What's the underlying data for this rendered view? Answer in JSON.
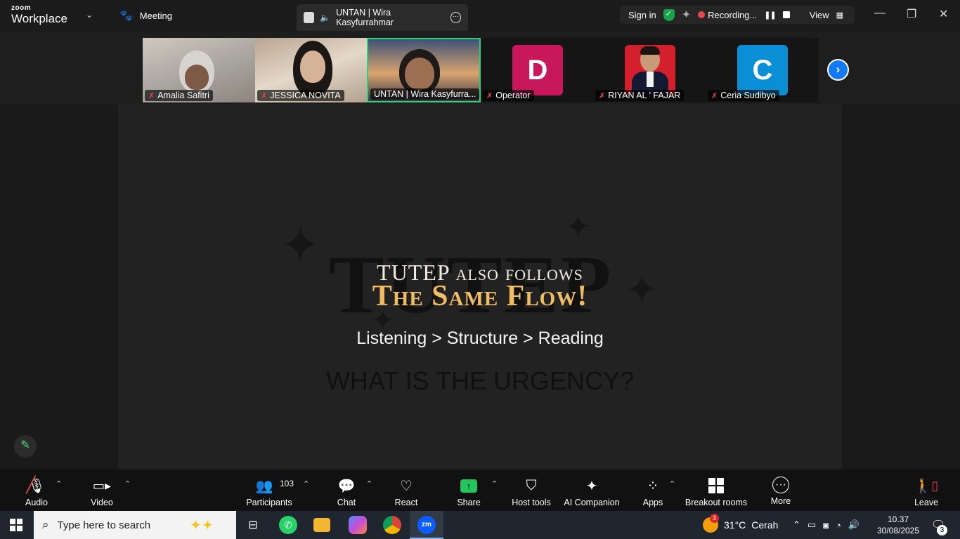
{
  "titlebar": {
    "logo_small": "zoom",
    "logo_large": "Workplace",
    "meeting_label": "Meeting",
    "active_speaker": "UNTAN | Wira Kasyfurrahmar",
    "sign_in": "Sign in",
    "recording": "Recording...",
    "view": "View"
  },
  "participants_strip": [
    {
      "name": "Amalia Safitri",
      "type": "video"
    },
    {
      "name": "JESSICA NOVITA",
      "type": "video"
    },
    {
      "name": "UNTAN | Wira Kasyfurra...",
      "type": "video",
      "active": true
    },
    {
      "name": "Operator",
      "type": "avatar",
      "initial": "D",
      "color": "#c8185a"
    },
    {
      "name": "RIYAN AL ' FAJAR",
      "type": "photo"
    },
    {
      "name": "Ceria Sudibyo",
      "type": "avatar",
      "initial": "C",
      "color": "#0a8fd6"
    }
  ],
  "slide": {
    "bg_word": "TUTEP",
    "line1": "TUTEP also follows",
    "line2": "The Same Flow!",
    "line3": "Listening > Structure > Reading",
    "line4": "WHAT IS THE URGENCY?"
  },
  "toolbar": {
    "audio": "Audio",
    "video": "Video",
    "participants": "Participants",
    "participant_count": "103",
    "chat": "Chat",
    "react": "React",
    "share": "Share",
    "host_tools": "Host tools",
    "ai_companion": "AI Companion",
    "apps": "Apps",
    "breakout_rooms": "Breakout rooms",
    "more": "More",
    "leave": "Leave"
  },
  "taskbar": {
    "search_placeholder": "Type here to search",
    "zoom_app": "zm",
    "weather_temp": "31°C",
    "weather_text": "Cerah",
    "weather_badge": "3",
    "time": "10.37",
    "date": "30/08/2025",
    "notifications": "3"
  },
  "colors": {
    "active_border": "#2fd07a",
    "share_green": "#22c55e",
    "record_red": "#e5484d",
    "accent_blue": "#1479f4",
    "slide_gold": "#f1bd62"
  }
}
